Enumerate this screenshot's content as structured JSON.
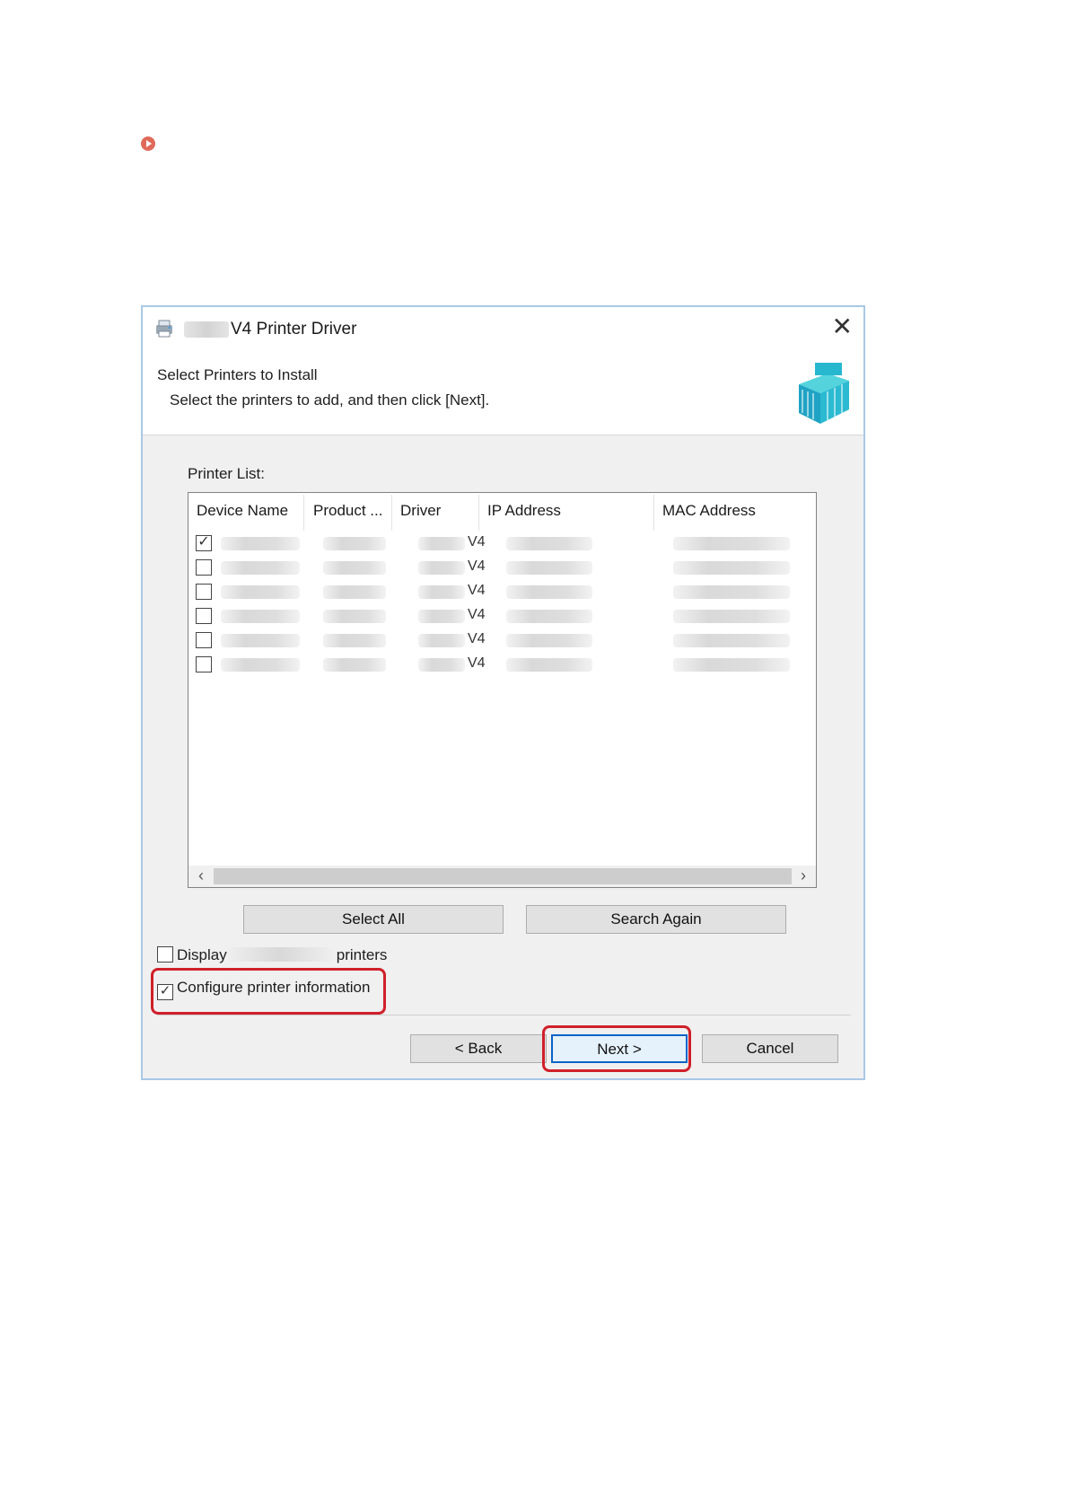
{
  "doc": {
    "bullet_icon": "circle-play-icon"
  },
  "dialog": {
    "title": "V4 Printer Driver",
    "close_label": "✕",
    "header_title": "Select Printers to Install",
    "header_subtitle": "Select the printers to add, and then click [Next].",
    "list_label": "Printer List:",
    "columns": [
      "Device Name",
      "Product ...",
      "Driver",
      "IP Address",
      "MAC Address"
    ],
    "rows": [
      {
        "checked": true,
        "driver": "V4"
      },
      {
        "checked": false,
        "driver": "V4"
      },
      {
        "checked": false,
        "driver": "V4"
      },
      {
        "checked": false,
        "driver": "V4"
      },
      {
        "checked": false,
        "driver": "V4"
      },
      {
        "checked": false,
        "driver": "V4"
      }
    ],
    "select_all": "Select All",
    "search_again": "Search Again",
    "display_prefix": "Display",
    "display_suffix": "printers",
    "display_checked": false,
    "configure_label": "Configure printer information",
    "configure_checked": true,
    "back": "< Back",
    "next": "Next >",
    "cancel": "Cancel",
    "highlight_color": "#d0202a",
    "focus_color": "#0a64c8"
  }
}
